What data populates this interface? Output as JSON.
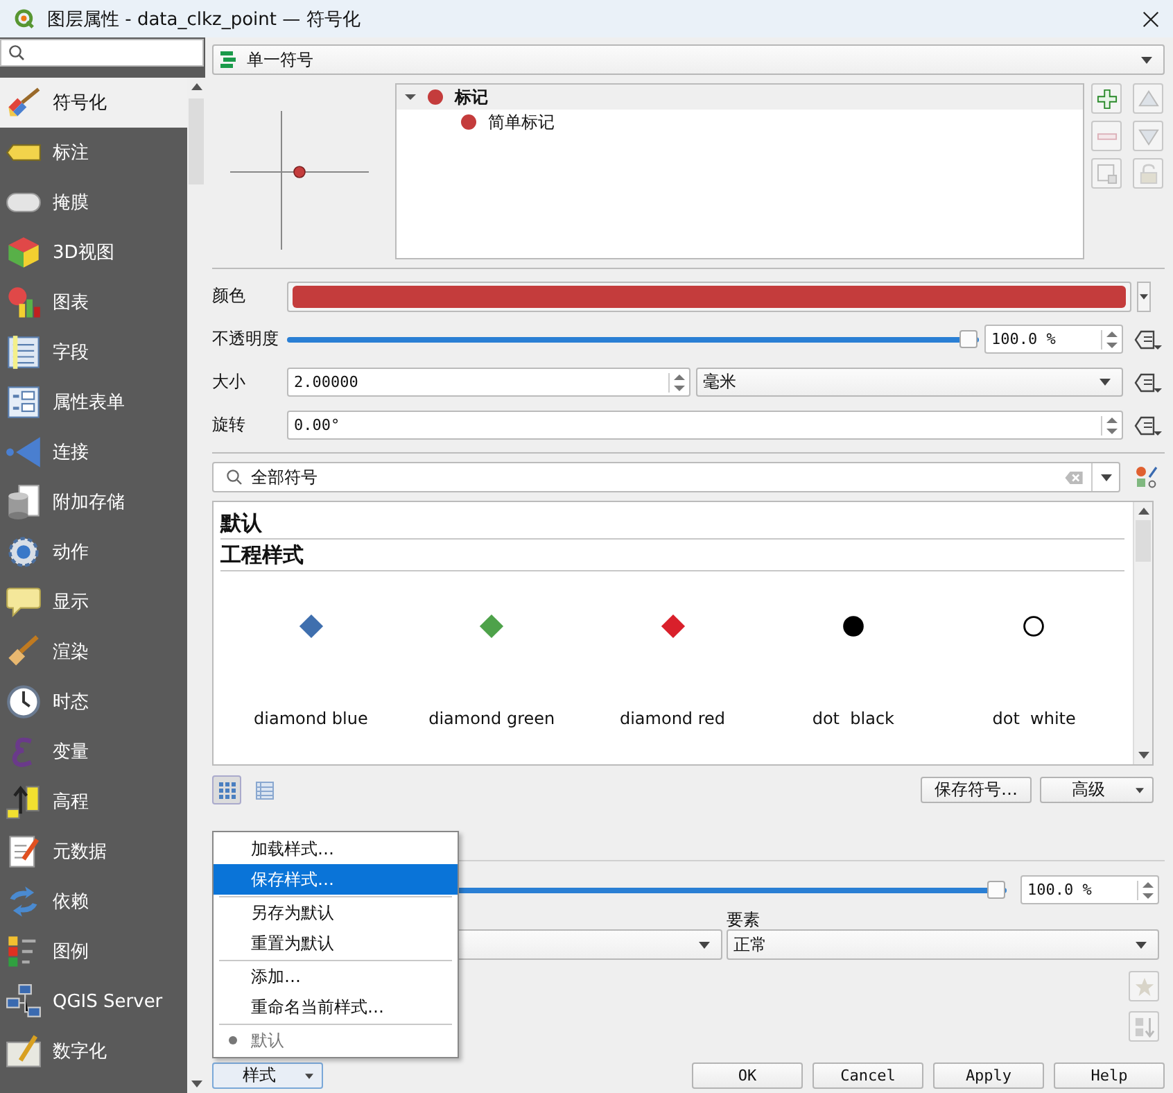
{
  "window": {
    "title": "图层属性 - data_clkz_point — 符号化"
  },
  "sidebar": {
    "items": [
      {
        "label": "符号化",
        "selected": true
      },
      {
        "label": "标注",
        "selected": false
      },
      {
        "label": "掩膜",
        "selected": false
      },
      {
        "label": "3D视图",
        "selected": false
      },
      {
        "label": "图表",
        "selected": false
      },
      {
        "label": "字段",
        "selected": false
      },
      {
        "label": "属性表单",
        "selected": false
      },
      {
        "label": "连接",
        "selected": false
      },
      {
        "label": "附加存储",
        "selected": false
      },
      {
        "label": "动作",
        "selected": false
      },
      {
        "label": "显示",
        "selected": false
      },
      {
        "label": "渲染",
        "selected": false
      },
      {
        "label": "时态",
        "selected": false
      },
      {
        "label": "变量",
        "selected": false
      },
      {
        "label": "高程",
        "selected": false
      },
      {
        "label": "元数据",
        "selected": false
      },
      {
        "label": "依赖",
        "selected": false
      },
      {
        "label": "图例",
        "selected": false
      },
      {
        "label": "QGIS Server",
        "selected": false
      },
      {
        "label": "数字化",
        "selected": false
      }
    ]
  },
  "renderer": {
    "value": "单一符号"
  },
  "symbol_tree": [
    {
      "label": "标记",
      "selected": true,
      "expanded": true,
      "children": [
        {
          "label": "简单标记",
          "selected": false
        }
      ]
    }
  ],
  "properties": [
    {
      "kind": "color",
      "label": "颜色",
      "color": "#c43c3c"
    },
    {
      "kind": "slider",
      "label": "不透明度",
      "level": 1.0,
      "value": "100.0 %"
    },
    {
      "kind": "size",
      "label": "大小",
      "value": "2.00000",
      "unit": "毫米"
    },
    {
      "kind": "spin",
      "label": "旋转",
      "value": "0.00°"
    }
  ],
  "symbol_search": {
    "value": "全部符号"
  },
  "library": {
    "groups": [
      "默认",
      "工程样式"
    ],
    "symbols": [
      {
        "label": "diamond blue",
        "kind": "diamond",
        "color": "#3f6fae"
      },
      {
        "label": "diamond green",
        "kind": "diamond",
        "color": "#4ea24a"
      },
      {
        "label": "diamond red",
        "kind": "diamond",
        "color": "#d9202b"
      },
      {
        "label": "dot  black",
        "kind": "dot",
        "color": "#000000"
      },
      {
        "label": "dot  white",
        "kind": "dot",
        "color": "#ffffff"
      }
    ]
  },
  "view_modes": [
    {
      "selected": true
    },
    {
      "selected": false
    }
  ],
  "save_symbol": "保存符号…",
  "advanced": "高级",
  "layer_rendering": {
    "opacity": {
      "level": 1.0,
      "value": "100.0 %"
    },
    "blend_label": "要素",
    "blend": "正常"
  },
  "style_menu": {
    "items": [
      {
        "kind": "action",
        "label": "加载样式…",
        "selected": false
      },
      {
        "kind": "action",
        "label": "保存样式…",
        "selected": true
      },
      {
        "kind": "separator"
      },
      {
        "kind": "action",
        "label": "另存为默认",
        "selected": false
      },
      {
        "kind": "action",
        "label": "重置为默认",
        "selected": false
      },
      {
        "kind": "separator"
      },
      {
        "kind": "action",
        "label": "添加…",
        "selected": false
      },
      {
        "kind": "action",
        "label": "重命名当前样式…",
        "selected": false
      },
      {
        "kind": "separator"
      },
      {
        "kind": "style",
        "label": "默认",
        "selected": false,
        "checked": true
      }
    ]
  },
  "style_button": "样式",
  "buttons": [
    "OK",
    "Cancel",
    "Apply",
    "Help"
  ]
}
